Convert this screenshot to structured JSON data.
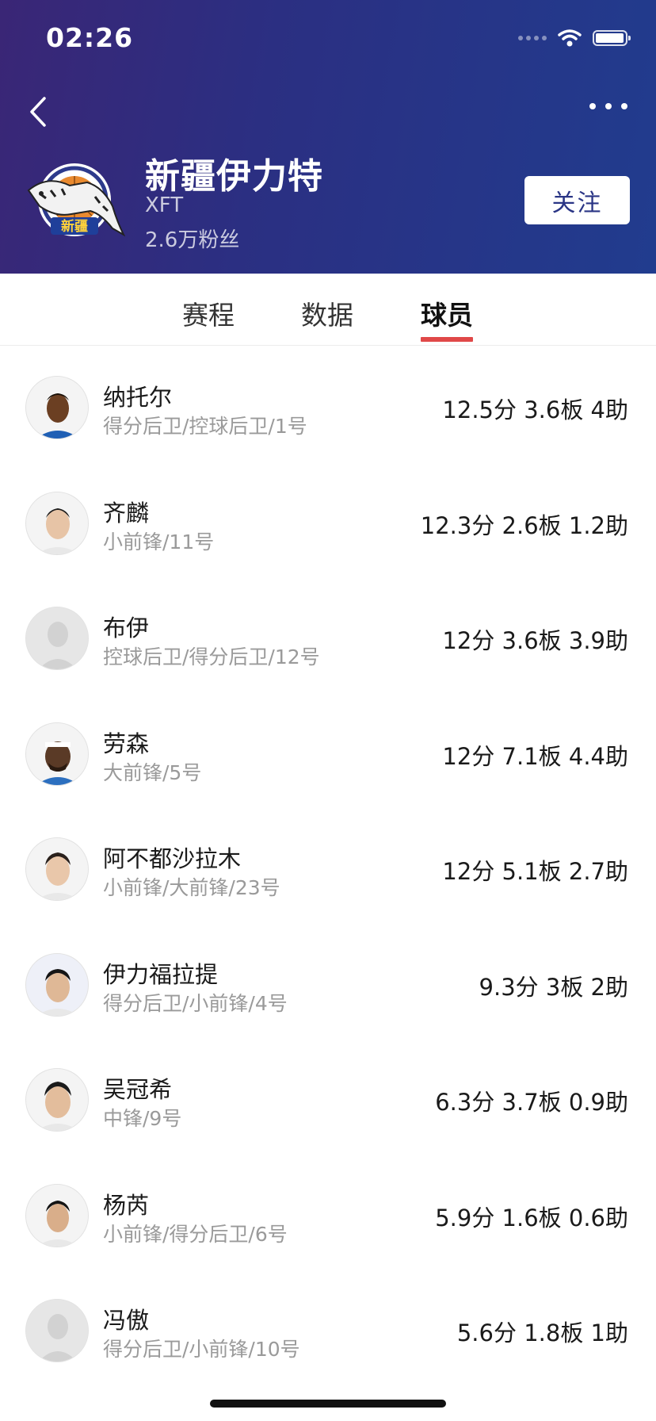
{
  "status_bar": {
    "time": "02:26"
  },
  "colors": {
    "header_start": "#3a2676",
    "header_end": "#213c8e",
    "tab_indicator": "#e04848",
    "follow_text": "#2a3585"
  },
  "header": {
    "back_icon": "chevron-left-icon",
    "more_icon": "more-horizontal-icon",
    "team_name": "新疆伊力特",
    "team_abbr": "XFT",
    "fans": "2.6万粉丝",
    "follow_label": "关注",
    "logo_text": "新疆"
  },
  "tabs": [
    {
      "label": "赛程",
      "active": false
    },
    {
      "label": "数据",
      "active": false
    },
    {
      "label": "球员",
      "active": true
    }
  ],
  "players": [
    {
      "name": "纳托尔",
      "position": "得分后卫/控球后卫/1号",
      "stats": "12.5分 3.6板 4助",
      "avatar": "photo"
    },
    {
      "name": "齐麟",
      "position": "小前锋/11号",
      "stats": "12.3分 2.6板 1.2助",
      "avatar": "photo"
    },
    {
      "name": "布伊",
      "position": "控球后卫/得分后卫/12号",
      "stats": "12分 3.6板 3.9助",
      "avatar": "placeholder"
    },
    {
      "name": "劳森",
      "position": "大前锋/5号",
      "stats": "12分 7.1板 4.4助",
      "avatar": "photo"
    },
    {
      "name": "阿不都沙拉木",
      "position": "小前锋/大前锋/23号",
      "stats": "12分 5.1板 2.7助",
      "avatar": "photo"
    },
    {
      "name": "伊力福拉提",
      "position": "得分后卫/小前锋/4号",
      "stats": "9.3分 3板 2助",
      "avatar": "photo"
    },
    {
      "name": "吴冠希",
      "position": "中锋/9号",
      "stats": "6.3分 3.7板 0.9助",
      "avatar": "photo"
    },
    {
      "name": "杨芮",
      "position": "小前锋/得分后卫/6号",
      "stats": "5.9分 1.6板 0.6助",
      "avatar": "photo"
    },
    {
      "name": "冯傲",
      "position": "得分后卫/小前锋/10号",
      "stats": "5.6分 1.8板 1助",
      "avatar": "placeholder"
    }
  ]
}
